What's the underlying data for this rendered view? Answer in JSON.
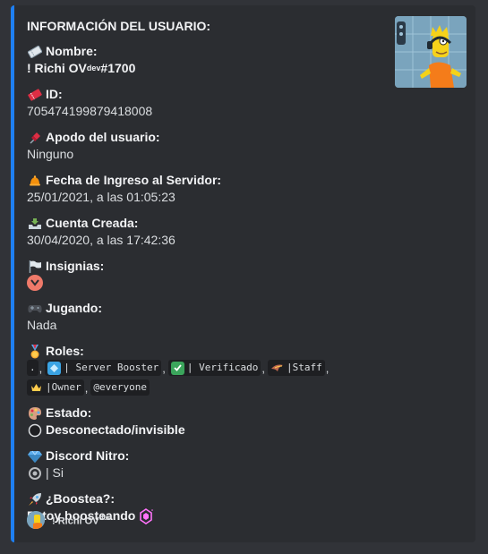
{
  "embed": {
    "accent_color": "#1e7ff2",
    "title": "INFORMACIÓN DEL USUARIO:",
    "fields": {
      "nombre": {
        "icon": "ticket-icon",
        "label": "Nombre:",
        "value": "! Richi OV",
        "value_sup": "dev",
        "value_suffix": "#1700"
      },
      "id": {
        "icon": "red-ticket-icon",
        "label": "ID:",
        "value": "705474199879418008"
      },
      "apodo": {
        "icon": "pushpin-icon",
        "label": "Apodo del usuario:",
        "value": "Ninguno"
      },
      "ingreso": {
        "icon": "bell-icon",
        "label": "Fecha de Ingreso al Servidor:",
        "value": "25/01/2021, a las 01:05:23"
      },
      "creada": {
        "icon": "inbox-tray-icon",
        "label": "Cuenta Creada:",
        "value": "30/04/2020, a las 17:42:36"
      },
      "insignias": {
        "icon": "white-flag-icon",
        "label": "Insignias:",
        "badge_icon": "hypesquad-badge-icon"
      },
      "jugando": {
        "icon": "game-controller-icon",
        "label": "Jugando:",
        "value": "Nada"
      },
      "roles": {
        "icon": "medal-icon",
        "label": "Roles:",
        "items": [
          {
            "icon": "",
            "name": "."
          },
          {
            "icon": "diamond-icon",
            "name": "| Server Booster"
          },
          {
            "icon": "check-icon",
            "name": "| Verificado"
          },
          {
            "icon": "bird-icon",
            "name": "|Staff"
          },
          {
            "icon": "crown-icon",
            "name": "|Owner"
          },
          {
            "icon": "",
            "name": "@everyone"
          }
        ],
        "separator": ","
      },
      "estado": {
        "icon": "palette-icon",
        "label": "Estado:",
        "status_icon": "offline-circle-icon",
        "value": "Desconectado/invisible"
      },
      "nitro": {
        "icon": "gem-icon",
        "label": "Discord Nitro:",
        "badge_icon": "nitro-badge-icon",
        "value": "| Si"
      },
      "boostea": {
        "icon": "rocket-icon",
        "label": "¿Boostea?:",
        "value": "Estoy boosteando",
        "badge_icon": "boost-gem-icon"
      }
    },
    "thumbnail": {
      "alt": "user-avatar"
    },
    "footer": {
      "text": "! Richi OV",
      "text_sup": "dev"
    }
  }
}
